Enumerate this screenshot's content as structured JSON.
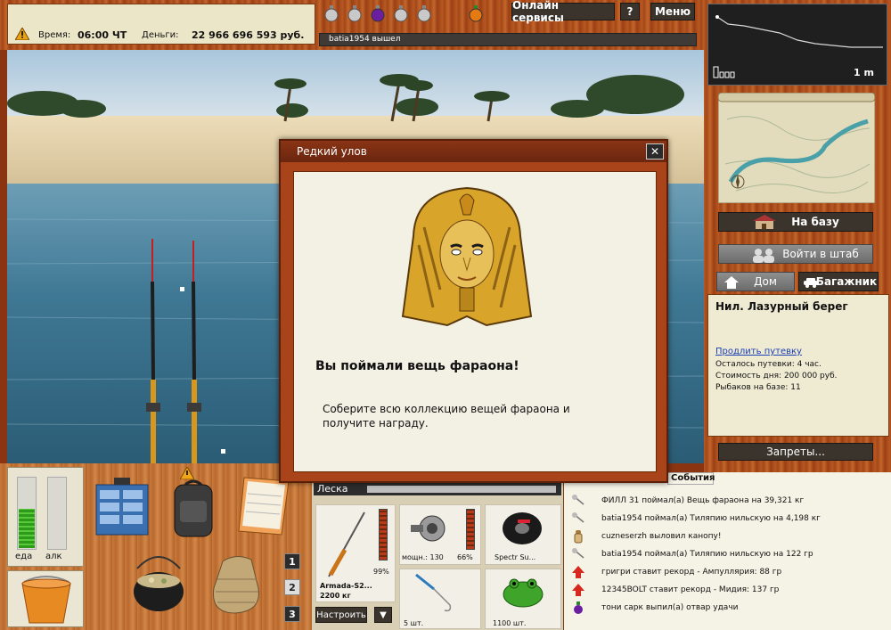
{
  "status": {
    "time_label": "Время:",
    "time_value": "06:00 ЧТ",
    "money_label": "Деньги:",
    "money_value": "22 966 696 593 руб."
  },
  "top_buttons": {
    "online": "Онлайн сервисы",
    "help": "?",
    "menu": "Меню"
  },
  "chat": {
    "message": "batia1954 вышел"
  },
  "depth": {
    "value": "1 m"
  },
  "nav": {
    "base": "На базу",
    "hq": "Войти в штаб",
    "home": "Дом",
    "trunk": "Багажник"
  },
  "location": {
    "title": "Нил. Лазурный берег",
    "extend_link": "Продлить путевку",
    "remaining": "Осталось путевки: 4 час.",
    "cost": "Стоимость дня: 200 000 руб.",
    "fishers": "Рыбаков на базе: 11"
  },
  "bans_button": "Запреты...",
  "meters": {
    "food": "еда",
    "alc": "алк",
    "food_level": 0.55,
    "alc_level": 0.0
  },
  "quick_slots": [
    "1",
    "2",
    "3"
  ],
  "line": {
    "label": "Леска"
  },
  "tackle": {
    "rod_name": "Armada-S2...",
    "rod_weight": "2200 кг",
    "rod_pct": "99%",
    "reel_power": "мощн.: 130",
    "reel_pct": "66%",
    "line_name": "Spectr Su...",
    "hook_count": "5 шт.",
    "bait_count": "1100 шт.",
    "adjust": "Настроить",
    "dropdown": "▼"
  },
  "events_tab": "События",
  "events": [
    "ФИЛЛ 31 поймал(а) Вещь фараона на 39,321 кг",
    "batia1954 поймал(а) Тиляпию нильскую на 4,198 кг",
    "cuzneserzh выловил канопу!",
    "batia1954 поймал(а) Тиляпию нильскую на 122 гр",
    "григри ставит рекорд - Ампуллярия: 88 гр",
    "12345BOLT ставит рекорд - Мидия: 137 гр",
    "тони сарк выпил(а) отвар удачи"
  ],
  "dialog": {
    "title": "Редкий улов",
    "close": "✕",
    "heading": "Вы поймали вещь фараона!",
    "body": "Соберите всю коллекцию вещей фараона и получите награду."
  },
  "colors": {
    "link": "#1a3fb5",
    "wood": "#b05520",
    "panel": "#efead2"
  }
}
